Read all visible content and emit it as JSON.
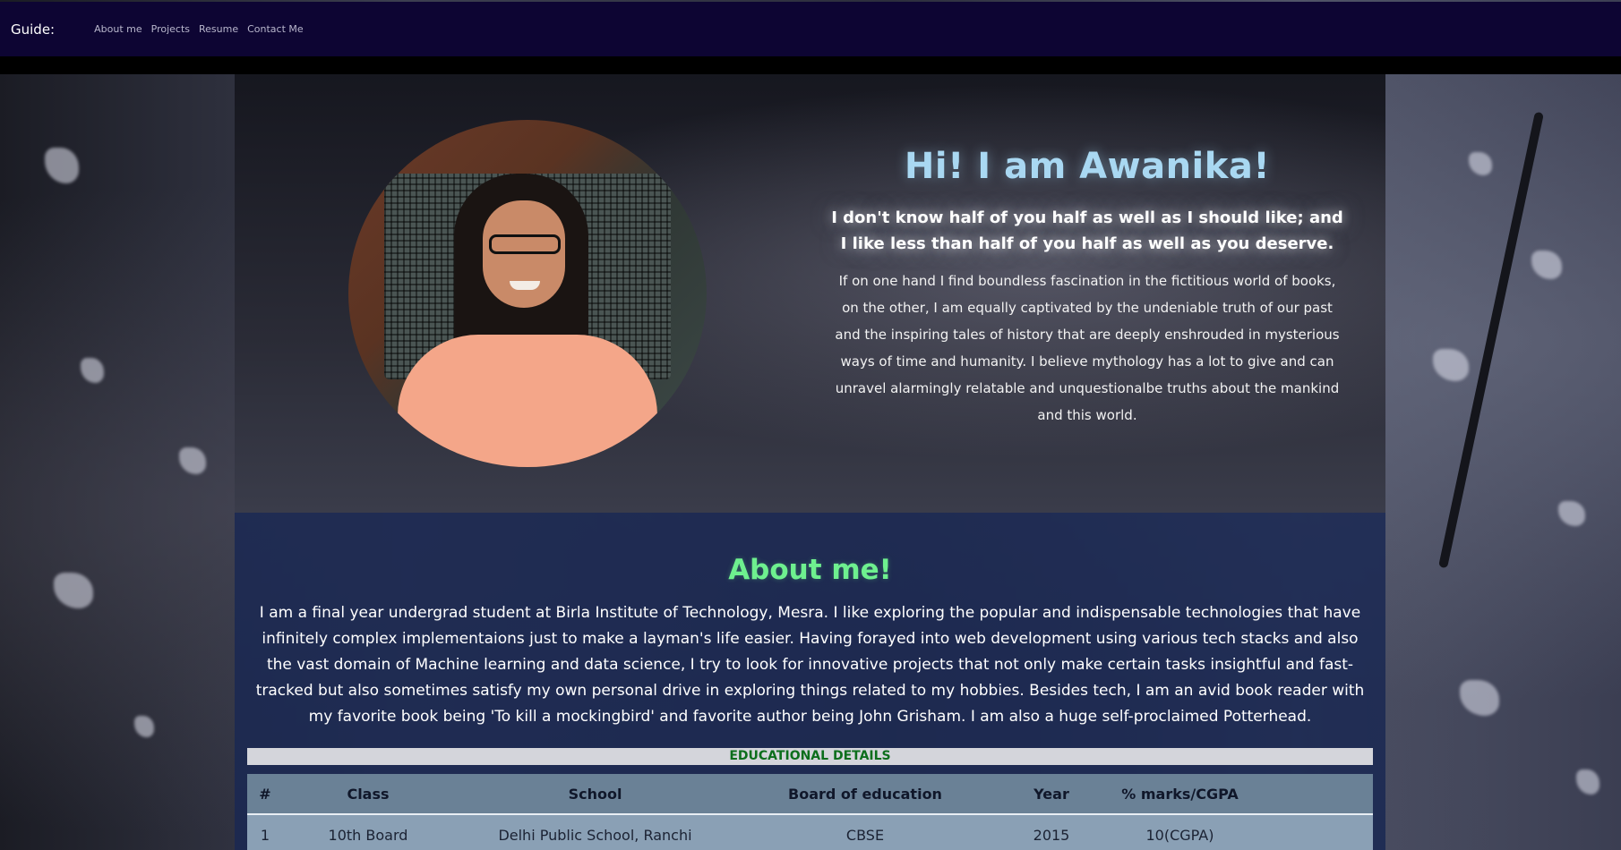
{
  "navbar": {
    "brand": "Guide:",
    "links": [
      "About me",
      "Projects",
      "Resume",
      "Contact Me"
    ]
  },
  "hero": {
    "title": "Hi! I am Awanika!",
    "quote": "I don't know half of you half as well as I should like; and I like less than half of you half as well as you deserve.",
    "paragraph": "If on one hand I find boundless fascination in the fictitious world of books, on the other, I am equally captivated by the undeniable truth of our past and the inspiring tales of history that are deeply enshrouded in mysterious ways of time and humanity. I believe mythology has a lot to give and can unravel alarmingly relatable and unquestionalbe truths about the mankind and this world."
  },
  "about": {
    "title": "About me!",
    "paragraph": "I am a final year undergrad student at Birla Institute of Technology, Mesra. I like exploring the popular and indispensable technologies that have infinitely complex implementaions just to make a layman's life easier. Having forayed into web development using various tech stacks and also the vast domain of Machine learning and data science, I try to look for innovative projects that not only make certain tasks insightful and fast-tracked but also sometimes satisfy my own personal drive in exploring things related to my hobbies. Besides tech, I am an avid book reader with my favorite book being 'To kill a mockingbird' and favorite author being John Grisham. I am also a huge self-proclaimed Potterhead."
  },
  "education": {
    "heading": "EDUCATIONAL DETAILS",
    "columns": [
      "#",
      "Class",
      "School",
      "Board of education",
      "Year",
      "% marks/CGPA"
    ],
    "rows": [
      [
        "1",
        "10th Board",
        "Delhi Public School, Ranchi",
        "CBSE",
        "2015",
        "10(CGPA)"
      ]
    ]
  },
  "colors": {
    "navbar_bg": "#0d0533",
    "hero_title": "#a9d8f2",
    "about_title": "#6ef08f",
    "edu_heading_text": "#0c6e1c"
  }
}
